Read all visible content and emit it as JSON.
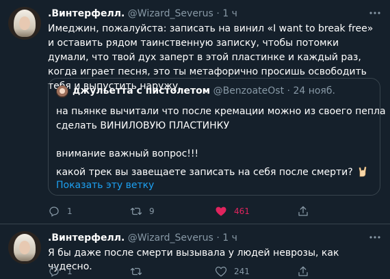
{
  "tweets": [
    {
      "author_name": ".Винтерфелл.",
      "author_handle": "@Wizard_Severus",
      "separator": "·",
      "time": "1 ч",
      "text": "Имеджин, пожалуйста: записать на винил «I want to break free» и оставить рядом таинственную записку, чтобы потомки думали, что твой дух заперт в этой пластинке и каждый раз, когда играет песня, это ты метафорично просишь освободить тебя и выпустить наружу.",
      "quote": {
        "author_name": "джульетта с пистолетом",
        "author_handle": "@BenzoateOst",
        "separator": "·",
        "date": "24 нояб.",
        "line1": "на пьянке вычитали что после кремации можно из своего пепла",
        "line2": "сделать ВИНИЛОВУЮ ПЛАСТИНКУ",
        "line3": "внимание важный вопрос!!!",
        "line4": "какой трек вы завещаете записать на себя после смерти?",
        "show_thread": "Показать эту ветку"
      },
      "counts": {
        "replies": "1",
        "retweets": "9",
        "likes": "461"
      },
      "liked": true
    },
    {
      "author_name": ".Винтерфелл.",
      "author_handle": "@Wizard_Severus",
      "separator": "·",
      "time": "1 ч",
      "text": "Я бы даже после смерти вызывала у людей неврозы, как чудесно.",
      "counts": {
        "replies": "1",
        "retweets": "",
        "likes": "241"
      },
      "liked": false
    }
  ],
  "icons": {
    "reply": "reply-icon",
    "retweet": "retweet-icon",
    "like": "heart-icon",
    "share": "share-icon",
    "more": "more-icon",
    "emoji": "rock-hand-emoji"
  },
  "colors": {
    "background": "#15202b",
    "border": "#38444d",
    "muted": "#8899a6",
    "link": "#1da1f2",
    "like": "#e0245e"
  }
}
